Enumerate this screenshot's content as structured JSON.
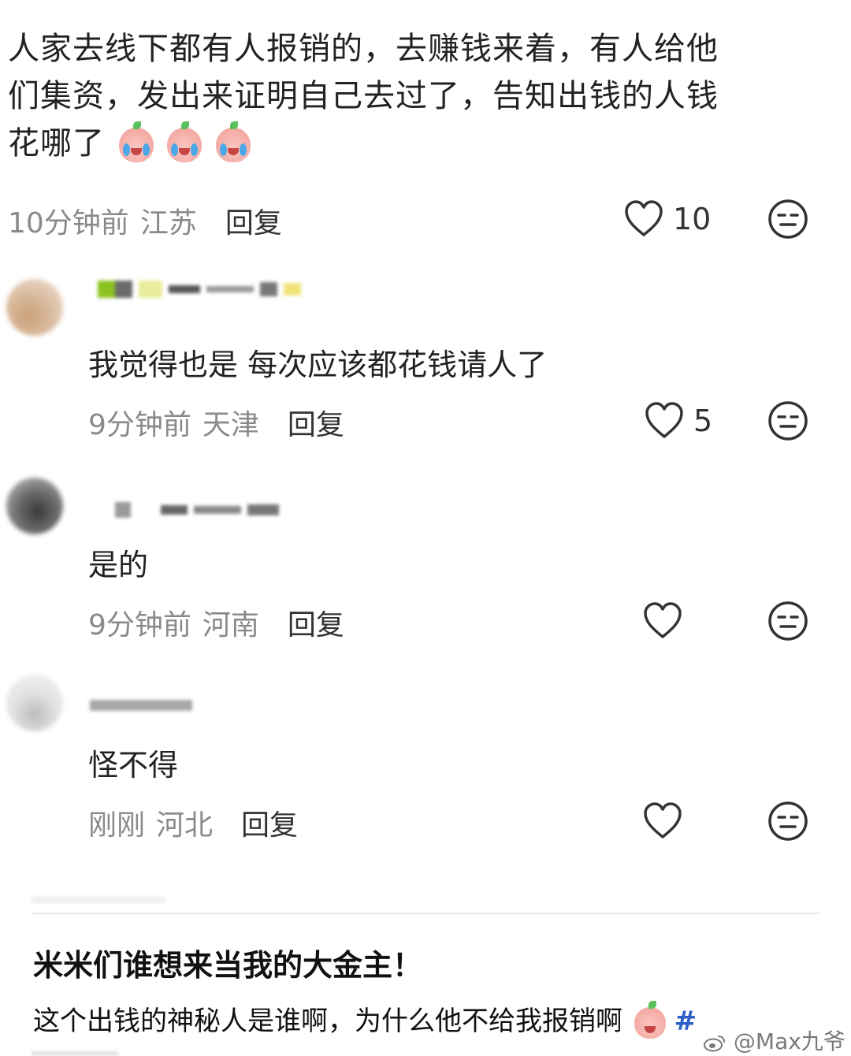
{
  "top_comment": {
    "lines": [
      "人家去线下都有人报销的，去赚钱来着，有人给他",
      "们集资，发出来证明自己去过了，告知出钱的人钱",
      "花哪了"
    ],
    "emoji_icon": "crying-laughing-peach-emoji",
    "time": "10分钟前",
    "location": "江苏",
    "reply_label": "回复",
    "like_count": "10"
  },
  "replies": [
    {
      "text": "我觉得也是 每次应该都花钱请人了",
      "time": "9分钟前",
      "location": "天津",
      "reply_label": "回复",
      "like_count": "5"
    },
    {
      "text": "是的",
      "time": "9分钟前",
      "location": "河南",
      "reply_label": "回复",
      "like_count": ""
    },
    {
      "text": "怪不得",
      "time": "刚刚",
      "location": "河北",
      "reply_label": "回复",
      "like_count": ""
    }
  ],
  "caption": {
    "title": "米米们谁想来当我的大金主！",
    "body": "这个出钱的神秘人是谁啊，为什么他不给我报销啊",
    "hashtag": "#"
  },
  "watermark": "@Max九爷",
  "icons": {
    "like": "heart-outline-icon",
    "dislike": "neutral-face-icon",
    "watermark_logo": "weibo-logo-icon"
  },
  "colors": {
    "meta_gray": "#8a8a8a",
    "text": "#222222",
    "hashtag_blue": "#2b5ec7"
  }
}
